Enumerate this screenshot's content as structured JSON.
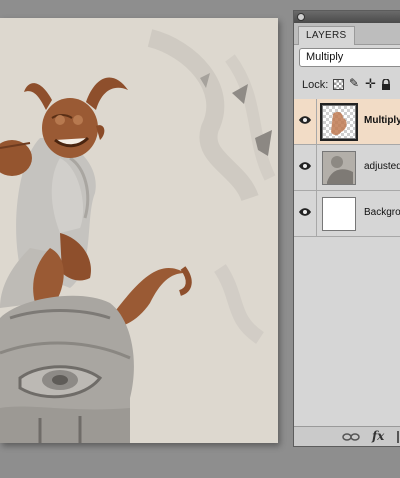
{
  "panel": {
    "tab_label": "LAYERS",
    "blend_mode": "Multiply",
    "lock_label": "Lock:"
  },
  "icons": {
    "close": "close-icon",
    "lock_transparent": "checkerboard-icon",
    "lock_brush": "brush-icon",
    "lock_move": "move-icon",
    "lock_all": "padlock-icon",
    "visibility": "eye-icon",
    "link": "link-icon",
    "fx": "fx-icon"
  },
  "layers": [
    {
      "name": "Multiply",
      "selected": true,
      "visible": true
    },
    {
      "name": "adjusted",
      "selected": false,
      "visible": true
    },
    {
      "name": "Backgro",
      "selected": false,
      "visible": true
    }
  ],
  "footer": {
    "fx_label": "fx"
  },
  "colors": {
    "selected_row": "#f2dcc6",
    "canvas_bg": "#ddd8cf",
    "character_skin": "#9a5a34"
  }
}
